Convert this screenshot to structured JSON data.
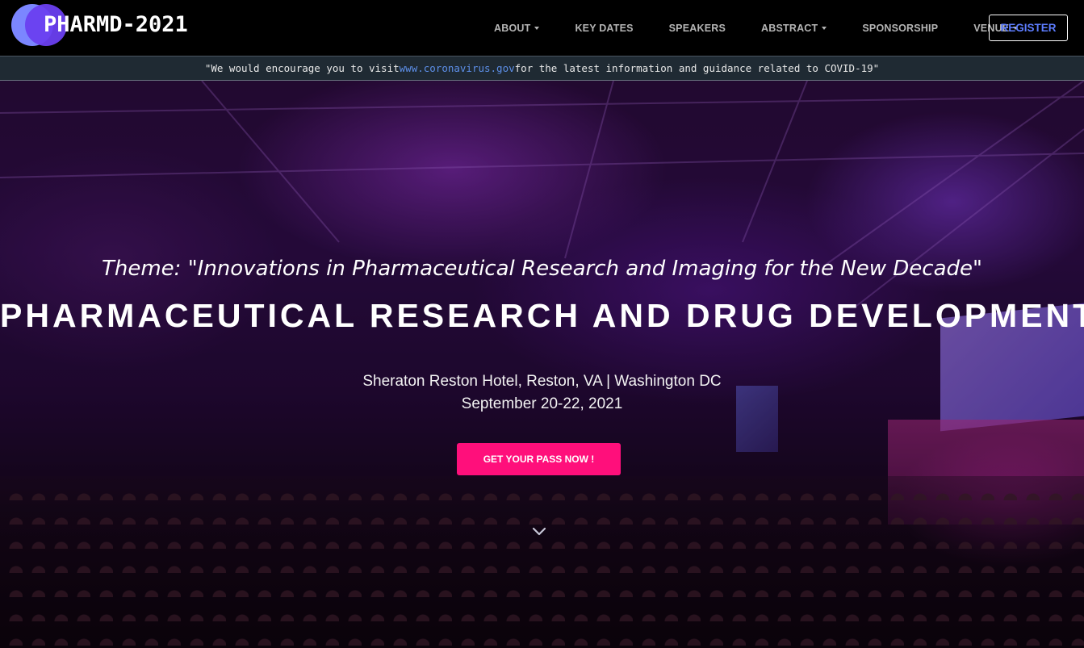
{
  "brand": {
    "logo_text": "PHARMD-2021"
  },
  "nav": {
    "items": [
      {
        "label": "ABOUT",
        "dropdown": true
      },
      {
        "label": "KEY DATES",
        "dropdown": false
      },
      {
        "label": "SPEAKERS",
        "dropdown": false
      },
      {
        "label": "ABSTRACT",
        "dropdown": true
      },
      {
        "label": "SPONSORSHIP",
        "dropdown": false
      },
      {
        "label": "VENUE",
        "dropdown": true
      }
    ],
    "register_label": "REGISTER"
  },
  "notice": {
    "prefix": "\"We would encourage you to visit ",
    "link": "www.coronavirus.gov",
    "suffix": " for the latest information and guidance related to COVID-19\""
  },
  "hero": {
    "theme": "Theme: \"Innovations in Pharmaceutical Research and Imaging for the New Decade\"",
    "title": "PHARMACEUTICAL RESEARCH AND DRUG DEVELOPMENT",
    "venue": "Sheraton Reston Hotel, Reston, VA | Washington DC",
    "date": "September 20-22, 2021",
    "cta_label": "GET YOUR PASS NOW !"
  },
  "colors": {
    "accent": "#ff0f7b",
    "register_text": "#5d7dff",
    "link": "#5d8fe8",
    "notice_bg": "#1f2a33"
  },
  "icons": {
    "scroll": "chevron-down-icon"
  }
}
